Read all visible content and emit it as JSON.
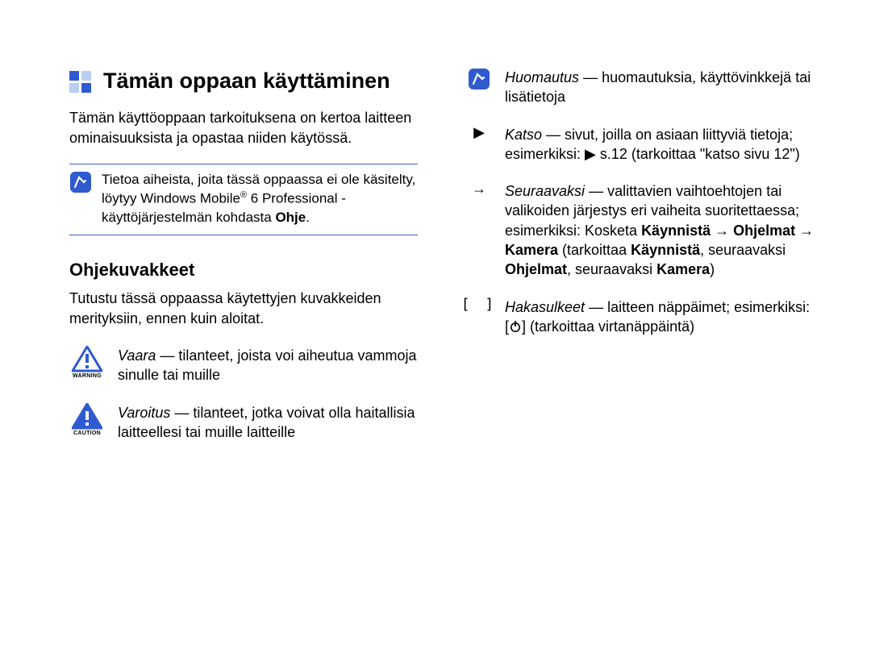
{
  "title": "Tämän oppaan käyttäminen",
  "intro": "Tämän käyttöoppaan tarkoituksena on kertoa laitteen ominaisuuksista ja opastaa niiden käytössä.",
  "note": {
    "pre": "Tietoa aiheista, joita tässä oppaassa ei ole käsitelty, löytyy Windows Mobile",
    "post": " 6 Professional -käyttöjärjestelmän kohdasta ",
    "help": "Ohje",
    "dot": "."
  },
  "subheading": "Ohjekuvakkeet",
  "sub_intro": "Tutustu tässä oppaassa käytettyjen kuvakkeiden merityksiin, ennen kuin aloitat.",
  "warning": {
    "label": "WARNING",
    "term": "Vaara",
    "text": " — tilanteet, joista voi aiheutua vammoja sinulle tai muille"
  },
  "caution": {
    "label": "CAUTION",
    "term": "Varoitus",
    "text": " — tilanteet, jotka voivat olla haitallisia laitteellesi tai muille laitteille"
  },
  "note2": {
    "term": "Huomautus",
    "text": " — huomautuksia, käyttövinkkejä tai lisätietoja"
  },
  "see": {
    "term": "Katso",
    "text": " — sivut, joilla on asiaan liittyviä tietoja; esimerkiksi: ",
    "example": " s.12 (tarkoittaa \"katso sivu 12\")"
  },
  "next": {
    "term": "Seuraavaksi",
    "text1": " — valittavien vaihtoehtojen tai valikoiden järjestys eri vaiheita suoritettaessa; esimerkiksi: Kosketa ",
    "b1": "Käynnistä",
    "arrow1": " → ",
    "b2": "Ohjelmat",
    "arrow2": " → ",
    "b3": "Kamera",
    "text2": " (tarkoittaa ",
    "b4": "Käynnistä",
    "text3": ", seuraavaksi ",
    "b5": "Ohjelmat",
    "text4": ", seuraavaksi ",
    "b6": "Kamera",
    "text5": ")"
  },
  "brackets": {
    "term": "Hakasulkeet",
    "text1": " — laitteen näppäimet; esimerkiksi: [",
    "text2": "] (tarkoittaa virtanäppäintä)"
  }
}
